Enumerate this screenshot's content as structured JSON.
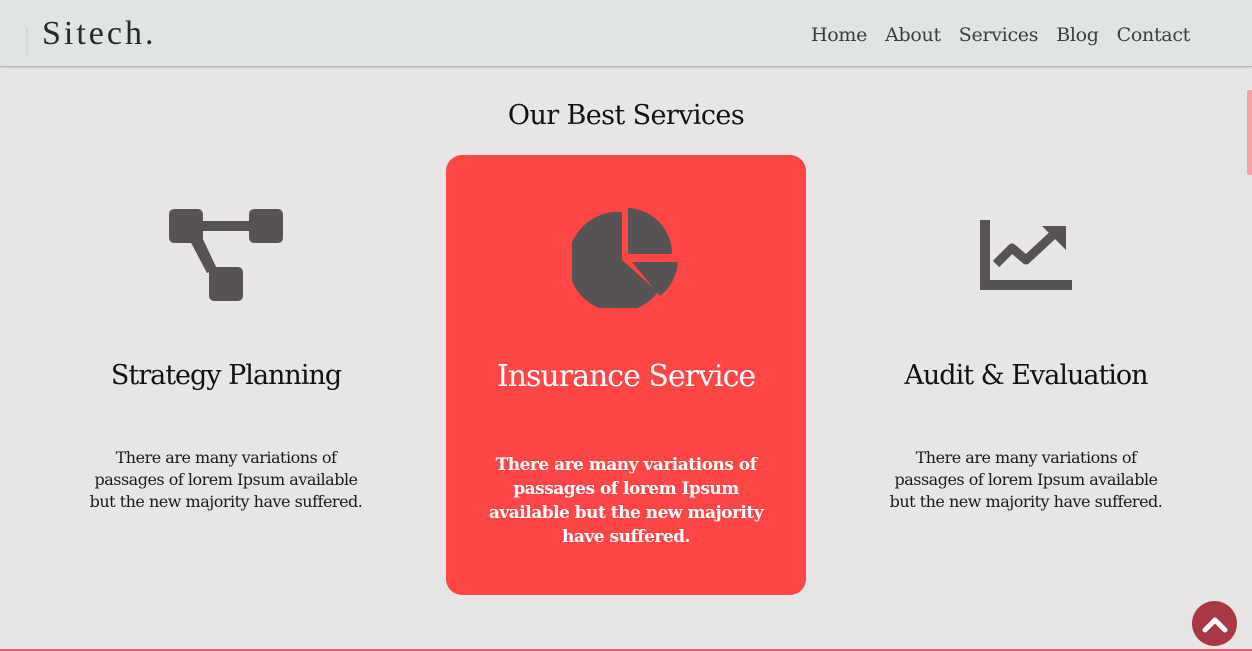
{
  "header": {
    "logo": "Sitech.",
    "nav": [
      "Home",
      "About",
      "Services",
      "Blog",
      "Contact"
    ]
  },
  "section": {
    "title": "Our Best Services"
  },
  "cards": [
    {
      "icon": "sitemap-icon",
      "title": "Strategy Planning",
      "text": "There are many variations of passages of lorem Ipsum available but the new majority have suffered."
    },
    {
      "icon": "pie-chart-icon",
      "title": "Insurance Service",
      "text": "There are many variations of passages of lorem Ipsum available but the new majority have suffered.",
      "highlighted": true
    },
    {
      "icon": "line-chart-icon",
      "title": "Audit & Evaluation",
      "text": "There are many variations of passages of lorem Ipsum available but the new majority have suffered."
    }
  ],
  "scroll_top_icon": "chevron-up-icon",
  "colors": {
    "accent": "#fe4646",
    "scroll_button": "#a93845",
    "icon": "#575355",
    "header_bg": "#e0e4e3",
    "page_bg": "#e7e5e6"
  }
}
